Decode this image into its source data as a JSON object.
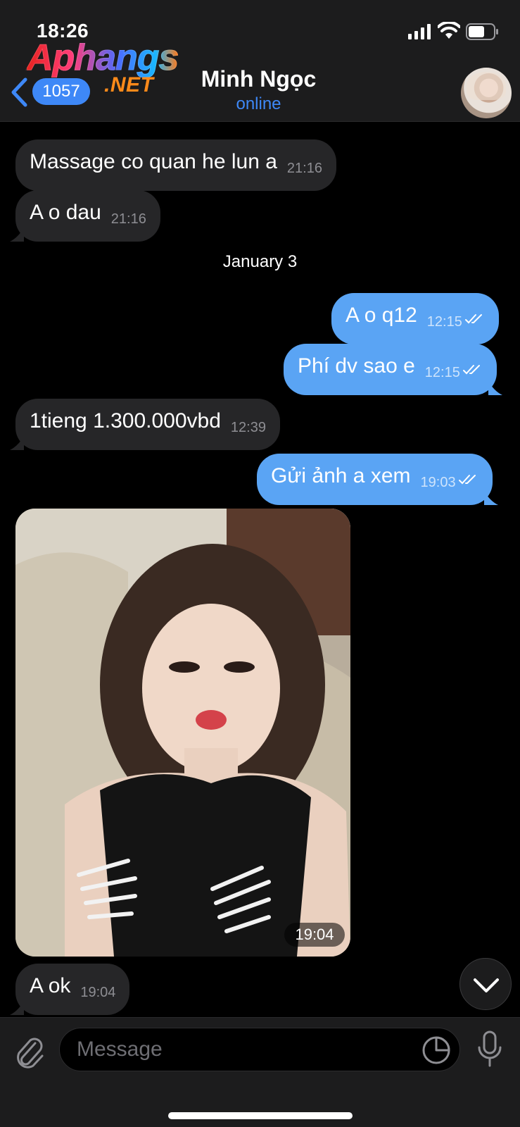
{
  "status_bar": {
    "time": "18:26",
    "signal_icon": "cellular-signal-icon",
    "wifi_icon": "wifi-icon",
    "battery_icon": "battery-icon"
  },
  "watermark": {
    "top_text": "Aphangs",
    "bottom_text": ".NET"
  },
  "header": {
    "back_icon": "chevron-left-icon",
    "unread_count": "1057",
    "contact_name": "Minh Ngọc",
    "contact_status": "online",
    "status_color": "#3e88f7"
  },
  "messages": [
    {
      "direction": "in",
      "text": "Massage co quan he lun a",
      "time": "21:16"
    },
    {
      "direction": "in",
      "text": "A o dau",
      "time": "21:16"
    },
    {
      "type": "date",
      "text": "January 3"
    },
    {
      "direction": "out",
      "text": "A o q12",
      "time": "12:15",
      "read": true
    },
    {
      "direction": "out",
      "text": "Phí dv sao e",
      "time": "12:15",
      "read": true
    },
    {
      "direction": "in",
      "text": "1tieng 1.300.000vbd",
      "time": "12:39"
    },
    {
      "direction": "out",
      "text": "Gửi ảnh a xem",
      "time": "19:03",
      "read": true
    },
    {
      "direction": "in",
      "type": "photo",
      "time": "19:04"
    },
    {
      "direction": "in",
      "text": "A ok",
      "time": "19:04"
    }
  ],
  "input_bar": {
    "placeholder": "Message",
    "attach_icon": "paperclip-icon",
    "sticker_icon": "sticker-icon",
    "mic_icon": "microphone-icon"
  },
  "colors": {
    "incoming_bubble": "#262628",
    "outgoing_bubble": "#5aa4f4",
    "accent": "#3e88f7",
    "background": "#000000"
  }
}
